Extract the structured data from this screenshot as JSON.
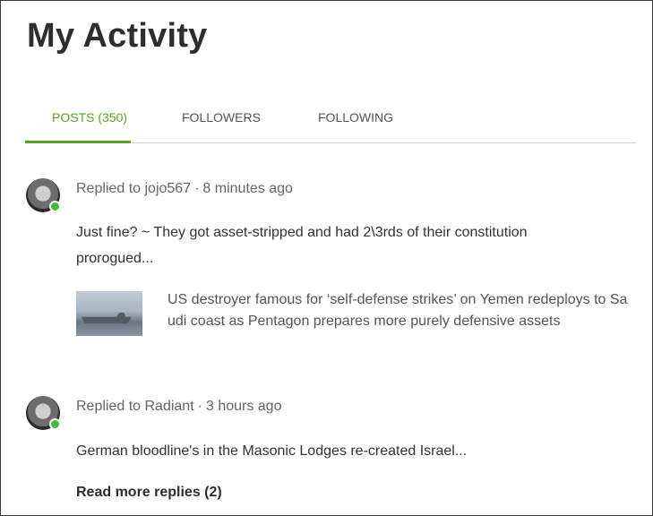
{
  "page": {
    "title": "My Activity"
  },
  "tabs": [
    {
      "label": "POSTS (350)",
      "active": true
    },
    {
      "label": "FOLLOWERS",
      "active": false
    },
    {
      "label": "FOLLOWING",
      "active": false
    }
  ],
  "colors": {
    "accent": "#5aa21f",
    "online": "#3bbf3b"
  },
  "activities": [
    {
      "replied_to": "Replied to jojo567",
      "time": "8 minutes ago",
      "text_line1": "Just fine? ~ They got asset-stripped and had 2\\3rds of their constitution",
      "text_line2": "prorogued...",
      "link": {
        "title": "US destroyer famous for ‘self-defense strikes’ on Yemen redeploys to Saudi coast as Pentagon prepares more purely defensive assets",
        "thumbnail_icon": "ship-image"
      }
    },
    {
      "replied_to": "Replied to Radiant",
      "time": "3 hours ago",
      "text_line1": "German bloodline's in the Masonic Lodges re-created Israel...",
      "read_more": "Read more replies (2)"
    }
  ],
  "separator": "·"
}
